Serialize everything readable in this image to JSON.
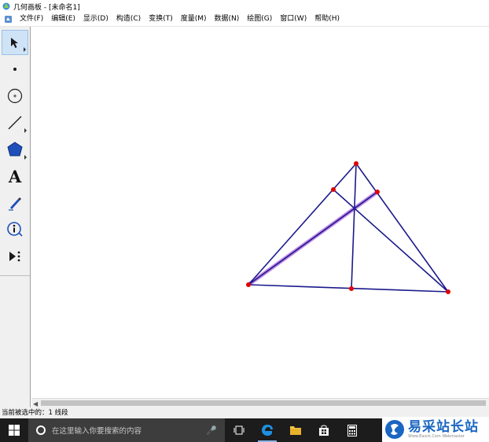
{
  "window": {
    "title": "几何画板 - [未命名1]"
  },
  "menubar": {
    "items": [
      "文件(F)",
      "编辑(E)",
      "显示(D)",
      "构造(C)",
      "变换(T)",
      "度量(M)",
      "数据(N)",
      "绘图(G)",
      "窗口(W)",
      "帮助(H)"
    ]
  },
  "toolbox": {
    "tools": [
      {
        "name": "arrow-select-tool",
        "active": true
      },
      {
        "name": "point-tool",
        "active": false
      },
      {
        "name": "compass-tool",
        "active": false
      },
      {
        "name": "line-tool",
        "active": false
      },
      {
        "name": "polygon-tool",
        "active": false
      },
      {
        "name": "text-tool",
        "active": false,
        "glyph": "A"
      },
      {
        "name": "marker-tool",
        "active": false
      },
      {
        "name": "information-tool",
        "active": false
      },
      {
        "name": "custom-tool",
        "active": false
      }
    ]
  },
  "status": {
    "text": "当前被选中的：1 线段"
  },
  "taskbar": {
    "search_placeholder": "在这里输入你要搜索的内容",
    "icons": [
      "task-view-icon",
      "edge-icon",
      "file-explorer-icon",
      "store-icon",
      "calculator-icon"
    ]
  },
  "watermark": {
    "main": "易采站长站",
    "sub": "Www.Easck.Com  Webmaster"
  },
  "colors": {
    "segment": "#1a1a8c",
    "point": "#e00000",
    "highlight": "#c48be8",
    "selection": "#cfe3f7"
  }
}
